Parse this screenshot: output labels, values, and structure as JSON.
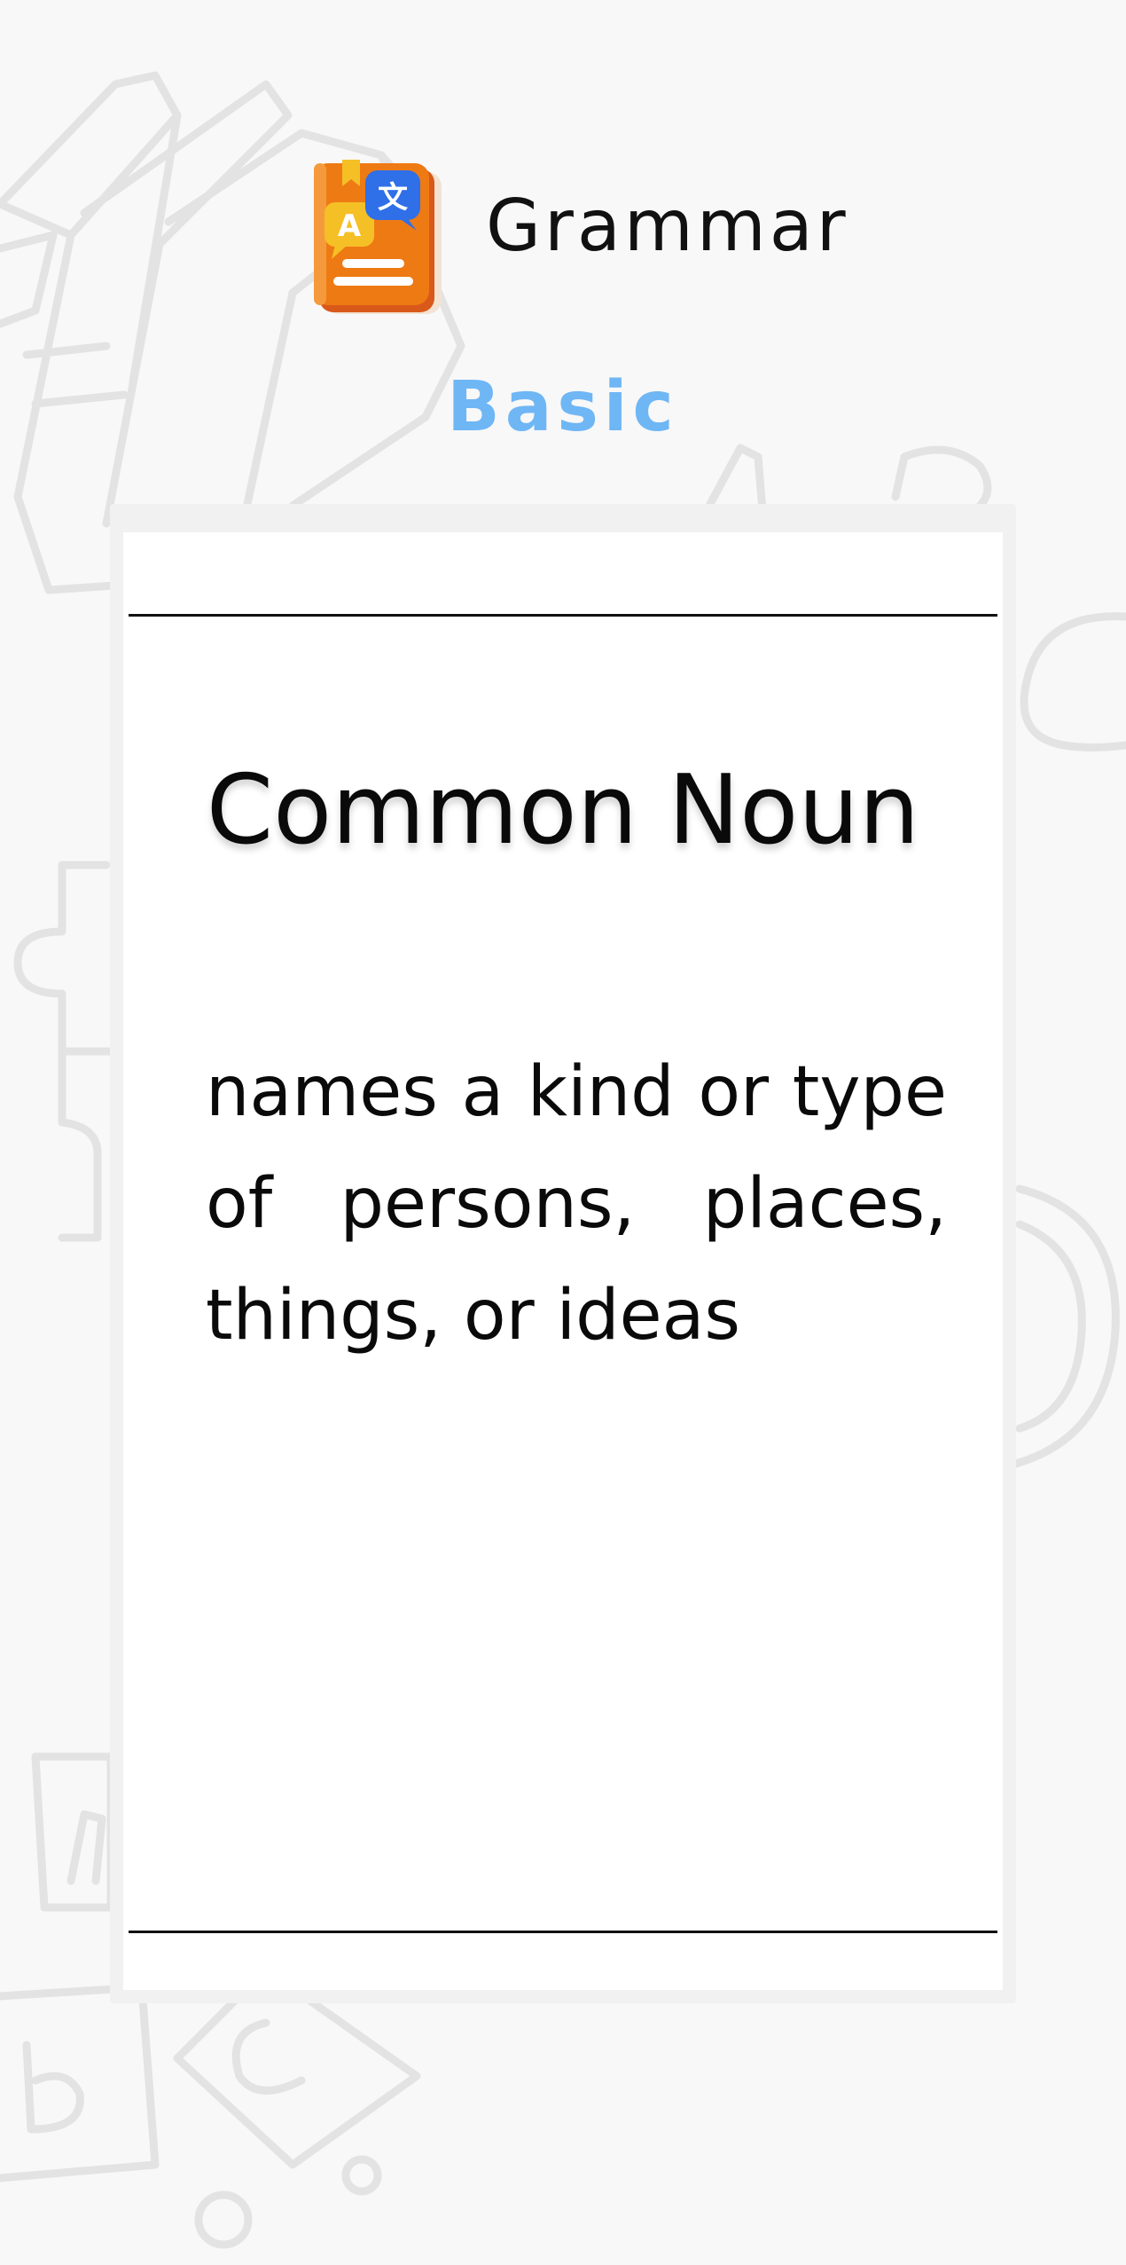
{
  "header": {
    "app_title": "Grammar",
    "icon": "grammar-book-translate-icon"
  },
  "level": {
    "label": "Basic",
    "color": "#6fb6f5"
  },
  "card": {
    "term": "Common Noun",
    "definition": "names a kind or type of persons, places, things, or ideas"
  },
  "colors": {
    "background": "#f8f8f8",
    "card": "#ffffff",
    "rule": "#111111",
    "icon_book": "#ee7a14",
    "icon_bubble_blue": "#2f6fe8",
    "icon_bubble_yellow": "#f5c026"
  }
}
